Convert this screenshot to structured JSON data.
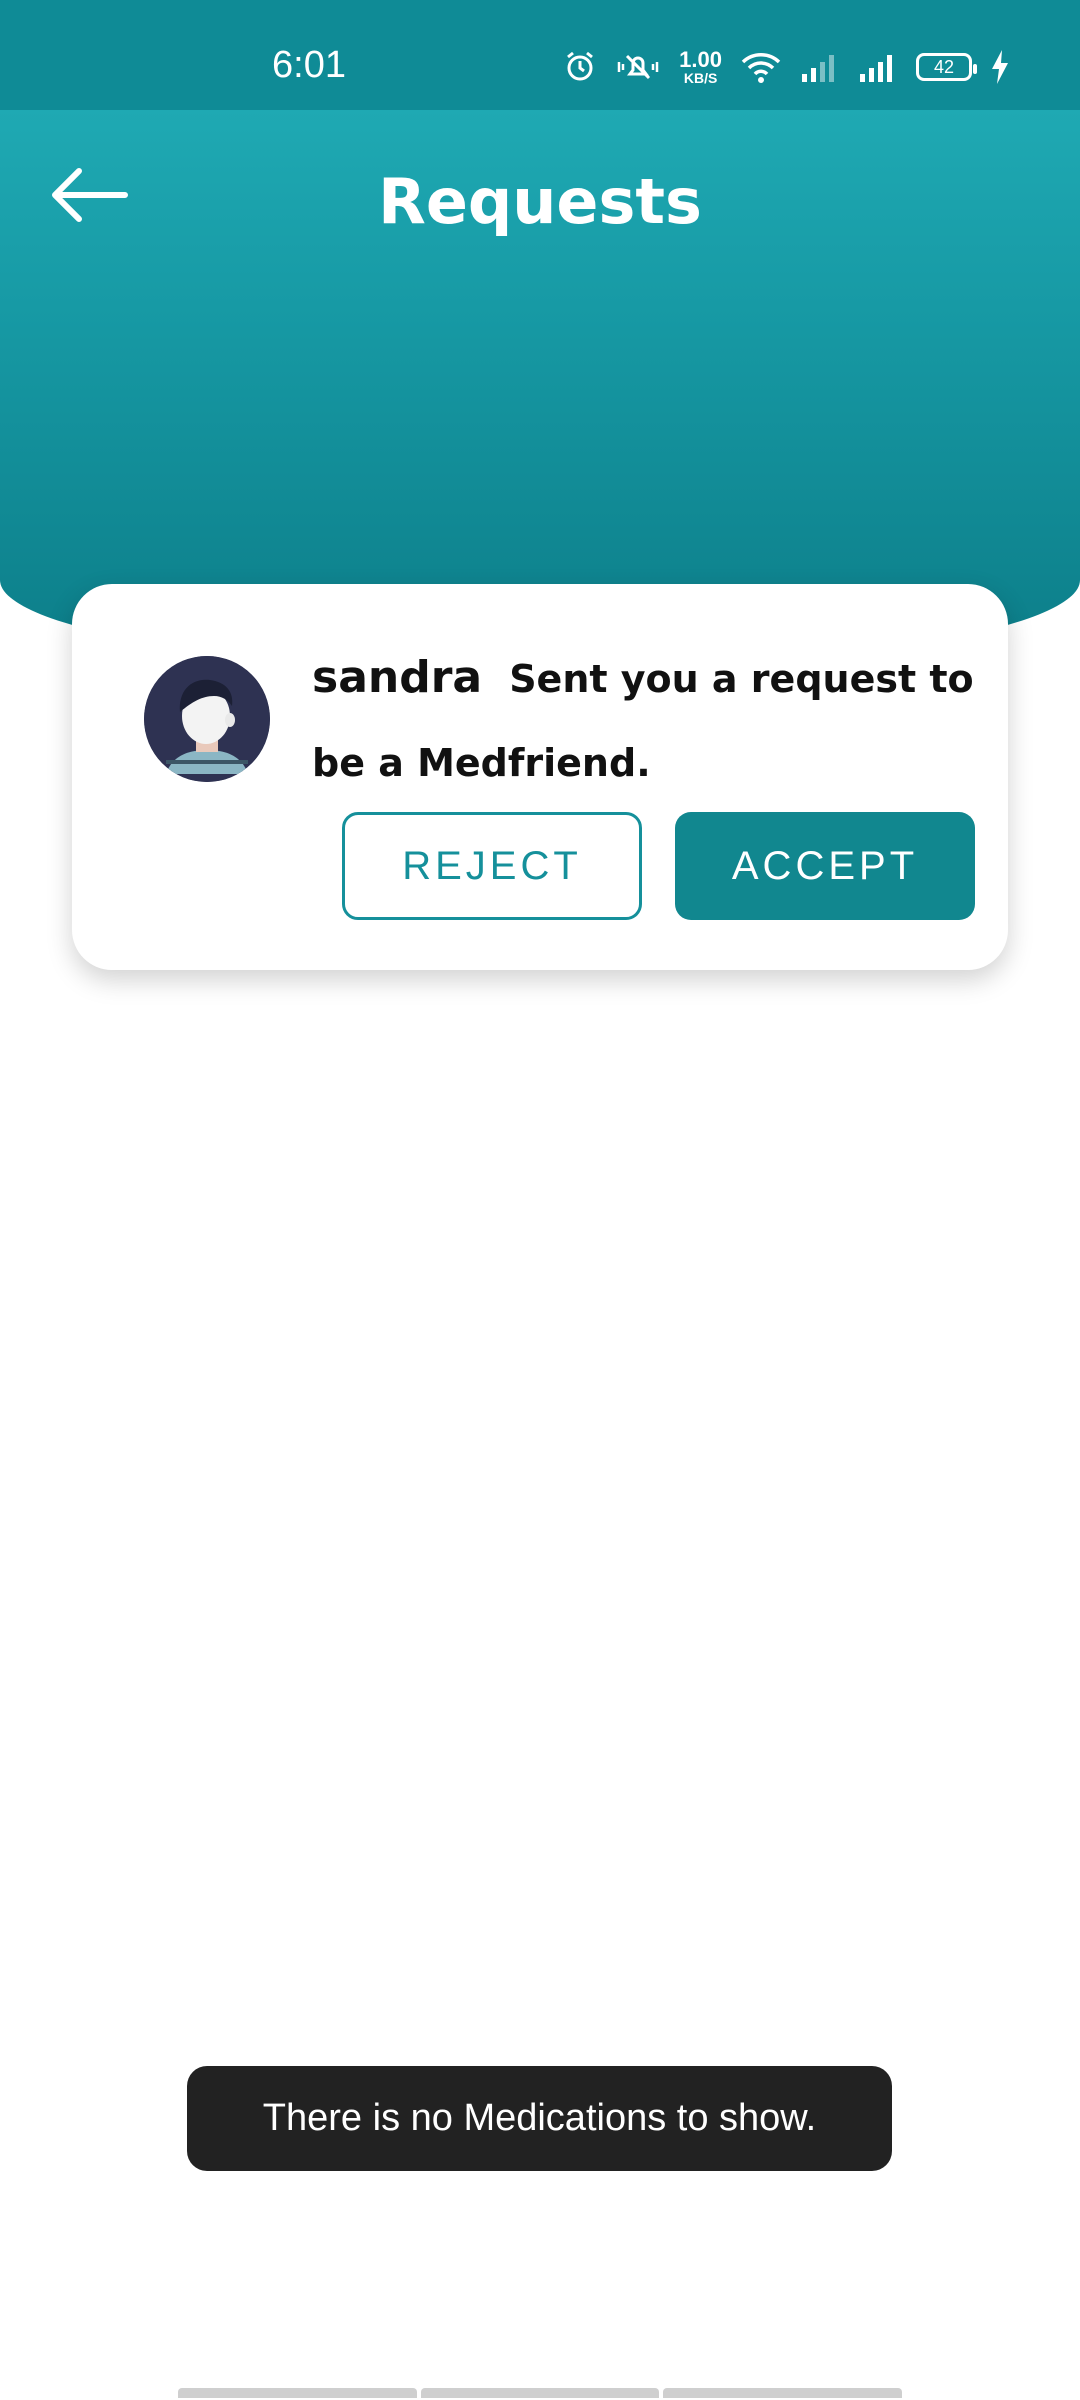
{
  "status_bar": {
    "time": "6:01",
    "network_speed_value": "1.00",
    "network_speed_unit": "KB/S",
    "battery_level": "42",
    "icons": [
      "alarm-icon",
      "silent-icon",
      "wifi-icon",
      "signal-icon",
      "signal-icon",
      "battery-icon",
      "charging-icon"
    ]
  },
  "header": {
    "title": "Requests",
    "back_icon": "arrow-left-icon",
    "colors": {
      "top": "#1fa9b3",
      "bottom": "#0c7d88"
    }
  },
  "request": {
    "name": "sandra",
    "message": "Sent you a request to be a Medfriend.",
    "reject_label": "REJECT",
    "accept_label": "ACCEPT",
    "accent_color": "#11878f"
  },
  "toast": {
    "message": "There is no Medications to show."
  }
}
